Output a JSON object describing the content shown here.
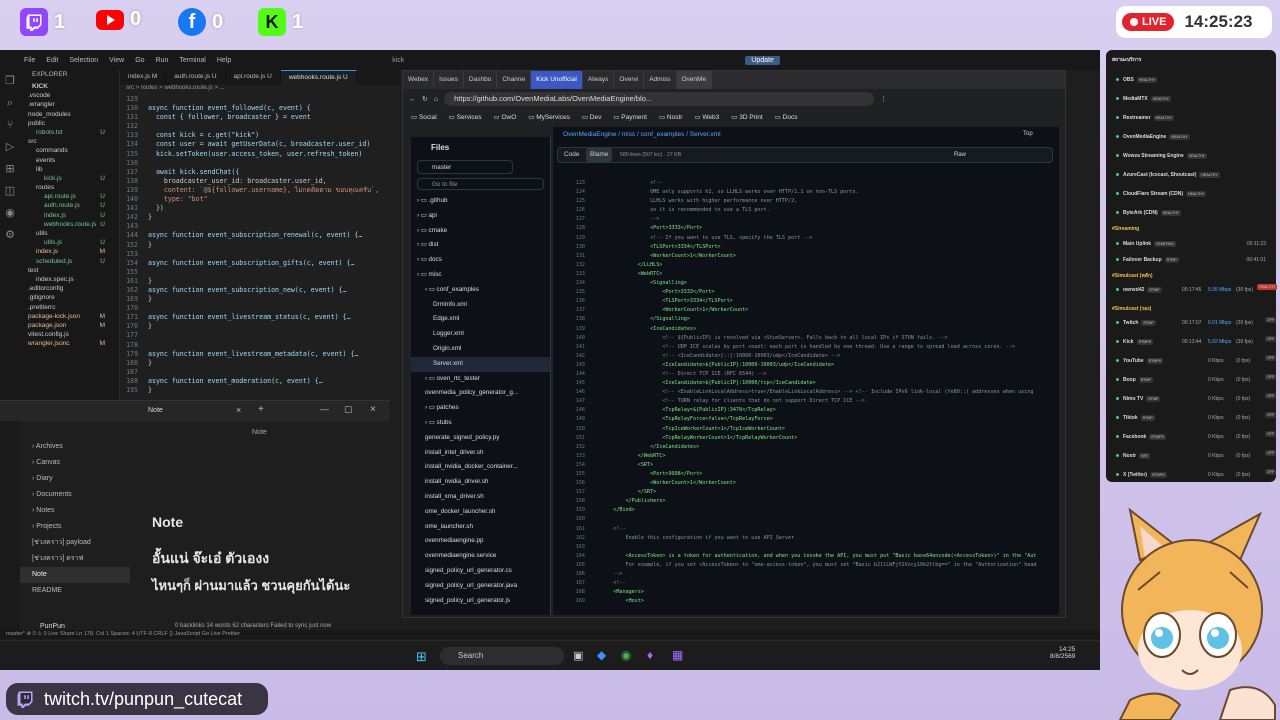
{
  "social": [
    {
      "icon": "twitch-icon",
      "count": "1",
      "color": "#9146ff"
    },
    {
      "icon": "youtube-icon",
      "count": "0",
      "color": "#ff0000"
    },
    {
      "icon": "facebook-icon",
      "count": "0",
      "color": "#1877f2"
    },
    {
      "icon": "kick-icon",
      "count": "1",
      "color": "#53fc18"
    }
  ],
  "live": {
    "label": "LIVE",
    "time": "14:25:23"
  },
  "vscode": {
    "menu": [
      "File",
      "Edit",
      "Selection",
      "View",
      "Go",
      "Run",
      "Terminal",
      "Help"
    ],
    "search": "kick",
    "update": "Update",
    "explorer_title": "EXPLORER",
    "project": "KICK",
    "tree": [
      {
        "n": ".vscode",
        "s": "",
        "i": 0
      },
      {
        "n": ".wrangler",
        "s": "",
        "i": 0
      },
      {
        "n": "node_modules",
        "s": "",
        "i": 0
      },
      {
        "n": "public",
        "s": "",
        "i": 0
      },
      {
        "n": "robots.txt",
        "s": "U",
        "i": 1
      },
      {
        "n": "src",
        "s": "",
        "i": 0
      },
      {
        "n": "commands",
        "s": "",
        "i": 1
      },
      {
        "n": "events",
        "s": "",
        "i": 1
      },
      {
        "n": "lib",
        "s": "",
        "i": 1
      },
      {
        "n": "kick.js",
        "s": "U",
        "i": 2
      },
      {
        "n": "routes",
        "s": "",
        "i": 1
      },
      {
        "n": "api.route.js",
        "s": "U",
        "i": 2
      },
      {
        "n": "auth.route.js",
        "s": "U",
        "i": 2
      },
      {
        "n": "index.js",
        "s": "U",
        "i": 2
      },
      {
        "n": "webhooks.route.js",
        "s": "U",
        "i": 2
      },
      {
        "n": "utils",
        "s": "",
        "i": 1
      },
      {
        "n": "utils.js",
        "s": "U",
        "i": 2
      },
      {
        "n": "index.js",
        "s": "M",
        "i": 1
      },
      {
        "n": "scheduled.js",
        "s": "U",
        "i": 1
      },
      {
        "n": "test",
        "s": "",
        "i": 0
      },
      {
        "n": "index.spec.js",
        "s": "",
        "i": 1
      },
      {
        "n": ".editorconfig",
        "s": "",
        "i": 0
      },
      {
        "n": ".gitignore",
        "s": "",
        "i": 0
      },
      {
        "n": ".prettierrc",
        "s": "",
        "i": 0
      },
      {
        "n": "package-lock.json",
        "s": "M",
        "i": 0
      },
      {
        "n": "package.json",
        "s": "M",
        "i": 0
      },
      {
        "n": "vitest.config.js",
        "s": "",
        "i": 0
      },
      {
        "n": "wrangler.jsonc",
        "s": "M",
        "i": 0
      }
    ],
    "tabs": [
      "index.js M",
      "auth.route.js U",
      "api.route.js U",
      "webhooks.route.js U"
    ],
    "breadcrumb": "src > routes > webhooks.route.js > ...",
    "code": [
      {
        "l": "129",
        "t": ""
      },
      {
        "l": "130",
        "t": "async function event_followed(c, event) {"
      },
      {
        "l": "131",
        "t": "  const { follower, broadcaster } = event"
      },
      {
        "l": "132",
        "t": ""
      },
      {
        "l": "133",
        "t": "  const kick = c.get(\"kick\")"
      },
      {
        "l": "134",
        "t": "  const user = await getUserData(c, broadcaster.user_id)"
      },
      {
        "l": "135",
        "t": "  kick.setToken(user.access_token, user.refresh_token)"
      },
      {
        "l": "136",
        "t": ""
      },
      {
        "l": "137",
        "t": "  await kick.sendChat({"
      },
      {
        "l": "138",
        "t": "    broadcaster_user_id: broadcaster.user_id,"
      },
      {
        "l": "139",
        "t": "    content: `@${follower.username}, ไม่กดติดตาม ขอบคุณครับ`,"
      },
      {
        "l": "140",
        "t": "    type: \"bot\""
      },
      {
        "l": "141",
        "t": "  })"
      },
      {
        "l": "142",
        "t": "}"
      },
      {
        "l": "143",
        "t": ""
      },
      {
        "l": "144",
        "t": "async function event_subscription_renewal(c, event) {…"
      },
      {
        "l": "152",
        "t": "}"
      },
      {
        "l": "153",
        "t": ""
      },
      {
        "l": "154",
        "t": "async function event_subscription_gifts(c, event) {…"
      },
      {
        "l": "155",
        "t": ""
      },
      {
        "l": "161",
        "t": "}"
      },
      {
        "l": "162",
        "t": "async function event_subscription_new(c, event) {…"
      },
      {
        "l": "169",
        "t": "}"
      },
      {
        "l": "170",
        "t": ""
      },
      {
        "l": "171",
        "t": "async function event_livestream_status(c, event) {…"
      },
      {
        "l": "176",
        "t": "}"
      },
      {
        "l": "177",
        "t": ""
      },
      {
        "l": "178",
        "t": ""
      },
      {
        "l": "179",
        "t": "async function event_livestream_metadata(c, event) {…"
      },
      {
        "l": "186",
        "t": "}"
      },
      {
        "l": "187",
        "t": ""
      },
      {
        "l": "188",
        "t": "async function event_moderation(c, event) {…"
      },
      {
        "l": "195",
        "t": "}"
      }
    ],
    "statusbar": "master*   ⊗ 0 ⚠ 0   Live Share   Ln 178, Col 1   Spaces: 4   UTF-8   CRLF   {} JavaScript   Go Live   Prettier"
  },
  "note": {
    "tab": "Note",
    "header": "Note",
    "sidebar": [
      "Archives",
      "Canvas",
      "Diary",
      "Documents",
      "Notes",
      "Projects",
      "[ช่วงคราว] payload",
      "[ช่วงคราว] ดราฟ",
      "Note",
      "README"
    ],
    "title": "Note",
    "line1": "อั้นแน่ จ๊ะเอ๋ ตัวเองง",
    "line2": "ไหนๆก็ ผ่านมาแล้ว ชวนคุยกันได้นะ",
    "vault": "PunPun",
    "footer": "0 backlinks   14 words  62 characters   Failed to sync just now"
  },
  "browser": {
    "tabs": [
      "Webex",
      "Issues",
      "Dashbo",
      "Channe",
      "Kick Unofficial",
      "Always",
      "Overvi",
      "Admiss",
      "OvenMe"
    ],
    "url": "https://github.com/OvenMediaLabs/OvenMediaEngine/blo...",
    "bookmarks": [
      "Social",
      "Services",
      "OwO",
      "MyServices",
      "Dev",
      "Payment",
      "Nostr",
      "Web3",
      "3D Print",
      "Docs"
    ],
    "files_title": "Files",
    "branch": "master",
    "goto": "Go to file",
    "files": [
      {
        "n": ".github",
        "d": 1
      },
      {
        "n": "api",
        "d": 1
      },
      {
        "n": "cmake",
        "d": 1
      },
      {
        "n": "dist",
        "d": 1
      },
      {
        "n": "docs",
        "d": 1
      },
      {
        "n": "misc",
        "d": 1
      },
      {
        "n": "conf_examples",
        "d": 2
      },
      {
        "n": "DrmInfo.xml",
        "d": 3
      },
      {
        "n": "Edge.xml",
        "d": 3
      },
      {
        "n": "Logger.xml",
        "d": 3
      },
      {
        "n": "Origin.xml",
        "d": 3
      },
      {
        "n": "Server.xml",
        "d": 3
      },
      {
        "n": "oven_rtc_tester",
        "d": 2
      },
      {
        "n": "ovenmedia_policy_generator_g...",
        "d": 2
      },
      {
        "n": "patches",
        "d": 2
      },
      {
        "n": "stubs",
        "d": 2
      },
      {
        "n": "generate_signed_policy.py",
        "d": 2
      },
      {
        "n": "install_intel_driver.sh",
        "d": 2
      },
      {
        "n": "install_nvidia_docker_container...",
        "d": 2
      },
      {
        "n": "install_nvidia_driver.sh",
        "d": 2
      },
      {
        "n": "install_xma_driver.sh",
        "d": 2
      },
      {
        "n": "ome_docker_launcher.sh",
        "d": 2
      },
      {
        "n": "ome_launcher.sh",
        "d": 2
      },
      {
        "n": "ovenmediaengine.pp",
        "d": 2
      },
      {
        "n": "ovenmediaengine.service",
        "d": 2
      },
      {
        "n": "signed_policy_url_generator.cs",
        "d": 2
      },
      {
        "n": "signed_policy_url_generator.java",
        "d": 2
      },
      {
        "n": "signed_policy_url_generator.js",
        "d": 2
      }
    ],
    "path": "OvenMediaEngine / misc / conf_examples / Server.xml",
    "code_tab": "Code",
    "blame_tab": "Blame",
    "lines_info": "580 lines (507 loc) · 27 KB",
    "raw": "Raw",
    "top": "Top",
    "xml": [
      [
        "123",
        "                <!--"
      ],
      [
        "124",
        "                OME only supports h2, so LLHLS works over HTTP/1.1 on non-TLS ports."
      ],
      [
        "125",
        "                LLHLS works with higher performance over HTTP/2,"
      ],
      [
        "126",
        "                so it is recommended to use a TLS port."
      ],
      [
        "127",
        "                -->"
      ],
      [
        "128",
        "                <Port>3333</Port>"
      ],
      [
        "129",
        "                <!-- If you want to use TLS, specify the TLS port -->"
      ],
      [
        "130",
        "                <TLSPort>3334</TLSPort>"
      ],
      [
        "131",
        "                <WorkerCount>1</WorkerCount>"
      ],
      [
        "132",
        "            </LLHLS>"
      ],
      [
        "133",
        "            <WebRTC>"
      ],
      [
        "134",
        "                <Signalling>"
      ],
      [
        "135",
        "                    <Port>3333</Port>"
      ],
      [
        "136",
        "                    <TLSPort>3334</TLSPort>"
      ],
      [
        "137",
        "                    <WorkerCount>1</WorkerCount>"
      ],
      [
        "138",
        "                </Signalling>"
      ],
      [
        "139",
        "                <IceCandidates>"
      ],
      [
        "140",
        "                    <!-- ${PublicIP} is resolved via <StunServer>. Falls back to all local IPs if STUN fails. -->"
      ],
      [
        "141",
        "                    <!-- UDP ICE scales by port count: each port is handled by one thread. Use a range to spread load across cores. -->"
      ],
      [
        "142",
        "                    <!-- <IceCandidate>[::]:10000-10003/udp</IceCandidate> -->"
      ],
      [
        "143",
        "                    <IceCandidate>${PublicIP}:10000-10003/udp</IceCandidate>"
      ],
      [
        "144",
        "                    <!-- Direct TCP ICE (RFC 6544) -->"
      ],
      [
        "145",
        "                    <IceCandidate>${PublicIP}:10000/tcp</IceCandidate>"
      ],
      [
        "146",
        "                    <!-- <EnableLinkLocalAddress>true</EnableLinkLocalAddress> --> <!-- Include IPv6 link-local (fe80::) addresses when using [::] -->"
      ],
      [
        "147",
        "                    <!-- TURN relay for clients that do not support Direct TCP ICE -->"
      ],
      [
        "148",
        "                    <TcpRelay>${PublicIP}:3478</TcpRelay>"
      ],
      [
        "149",
        "                    <TcpRelayForce>false</TcpRelayForce>"
      ],
      [
        "150",
        "                    <TcpIceWorkerCount>1</TcpIceWorkerCount>"
      ],
      [
        "151",
        "                    <TcpRelayWorkerCount>1</TcpRelayWorkerCount>"
      ],
      [
        "152",
        "                </IceCandidates>"
      ],
      [
        "153",
        "            </WebRTC>"
      ],
      [
        "154",
        "            <SRT>"
      ],
      [
        "155",
        "                <Port>9998</Port>"
      ],
      [
        "156",
        "                <WorkerCount>1</WorkerCount>"
      ],
      [
        "157",
        "            </SRT>"
      ],
      [
        "158",
        "        </Publishers>"
      ],
      [
        "159",
        "    </Bind>"
      ],
      [
        "160",
        ""
      ],
      [
        "161",
        "    <!--"
      ],
      [
        "162",
        "        Enable this configuration if you want to use API Server"
      ],
      [
        "163",
        ""
      ],
      [
        "164",
        "        <AccessToken> is a token for authentication, and when you invoke the API, you must put \"Basic base64encode(<AccessToken>)\" in the \"Authori"
      ],
      [
        "165",
        "        For example, if you set <AccessToken> to \"ome-access-token\", you must set \"Basic b21lLWFjY2Vzcy10b2tlbg==\" in the \"Authorization\" header."
      ],
      [
        "166",
        "    -->"
      ],
      [
        "167",
        "    <!--"
      ],
      [
        "168",
        "    <Managers>"
      ],
      [
        "169",
        "        <Host>"
      ]
    ]
  },
  "taskbar": {
    "search": "Search",
    "time": "14:25",
    "date": "8/8/2569"
  },
  "panel": {
    "section1": "สถานะบริการ",
    "services": [
      {
        "n": "OBS",
        "b": "HEALTHY"
      },
      {
        "n": "MediaMTX",
        "b": "HEALTHY"
      },
      {
        "n": "Restreamer",
        "b": "HEALTHY"
      },
      {
        "n": "OvenMediaEngine",
        "b": "HEALTHY"
      },
      {
        "n": "Wowza Streaming Engine",
        "b": "HEALTHY"
      },
      {
        "n": "AzureCast (Icecast, Shoutcast)",
        "b": "HEALTHY"
      },
      {
        "n": "CloudFlare Stream (CDN)",
        "b": "HEALTHY"
      },
      {
        "n": "ByteArk (CDN)",
        "b": "HEALTHY"
      }
    ],
    "section2": "#Streaming",
    "streaming": [
      {
        "n": "Main Uplink",
        "b": "STARTING",
        "v": "00:11:23"
      },
      {
        "n": "Failover Backup",
        "b": "RTMP",
        "v": "00:41:01"
      }
    ],
    "section3": "#Simulcast (หลัก)",
    "sim1": [
      {
        "n": "owned42",
        "b": "RTMP",
        "t": "00:17:45",
        "r": "5.95 Mbps",
        "f": "(30 fps)",
        "s": "HEALTHY"
      }
    ],
    "section4": "#Simulcast (รอง)",
    "sim2": [
      {
        "n": "Twitch",
        "b": "RTMP",
        "t": "00:17:07",
        "r": "6.01 Mbps",
        "f": "(30 fps)"
      },
      {
        "n": "Kick",
        "b": "RTMPS",
        "t": "00:13:44",
        "r": "5.92 Mbps",
        "f": "(30 fps)"
      },
      {
        "n": "YouTube",
        "b": "RTMPS",
        "t": "",
        "r": "0 Kbps",
        "f": "(0 fps)"
      },
      {
        "n": "Boop",
        "b": "RTMP",
        "t": "",
        "r": "0 Kbps",
        "f": "(0 fps)"
      },
      {
        "n": "Nimo TV",
        "b": "RTMP",
        "t": "",
        "r": "0 Kbps",
        "f": "(0 fps)"
      },
      {
        "n": "Tiktok",
        "b": "RTMP",
        "t": "",
        "r": "0 Kbps",
        "f": "(0 fps)"
      },
      {
        "n": "Facebook",
        "b": "RTMPS",
        "t": "",
        "r": "0 Kbps",
        "f": "(0 fps)"
      },
      {
        "n": "Nostr",
        "b": "SRT",
        "t": "",
        "r": "0 Kbps",
        "f": "(0 fps)"
      },
      {
        "n": "X (Twitter)",
        "b": "RTMPS",
        "t": "",
        "r": "0 Kbps",
        "f": "(0 fps)"
      }
    ]
  },
  "channel": "twitch.tv/punpun_cutecat"
}
